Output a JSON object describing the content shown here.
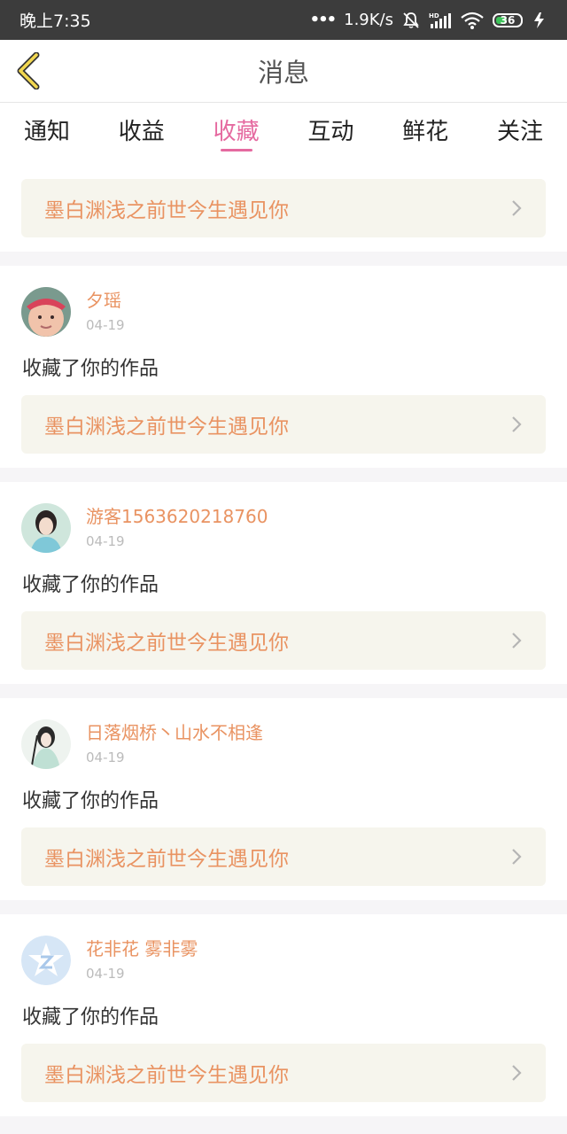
{
  "status_bar": {
    "time": "晚上7:35",
    "network_speed": "1.9K/s",
    "battery": "36",
    "icons": [
      "mute-icon",
      "signal-icon",
      "wifi-icon",
      "battery-icon",
      "charging-icon"
    ]
  },
  "header": {
    "title": "消息",
    "back_icon": "chevron-left-icon"
  },
  "tabs": [
    {
      "label": "通知",
      "active": false
    },
    {
      "label": "收益",
      "active": false
    },
    {
      "label": "收藏",
      "active": true
    },
    {
      "label": "互动",
      "active": false
    },
    {
      "label": "鲜花",
      "active": false
    },
    {
      "label": "关注",
      "active": false
    }
  ],
  "top_book": {
    "title": "墨白渊浅之前世今生遇见你"
  },
  "items": [
    {
      "user": "夕瑶",
      "date": "04-19",
      "action": "收藏了你的作品",
      "book": "墨白渊浅之前世今生遇见你"
    },
    {
      "user": "游客1563620218760",
      "date": "04-19",
      "action": "收藏了你的作品",
      "book": "墨白渊浅之前世今生遇见你"
    },
    {
      "user": "日落烟桥丶山水不相逢",
      "date": "04-19",
      "action": "收藏了你的作品",
      "book": "墨白渊浅之前世今生遇见你"
    },
    {
      "user": "花非花 雾非雾",
      "date": "04-19",
      "action": "收藏了你的作品",
      "book": "墨白渊浅之前世今生遇见你"
    }
  ],
  "colors": {
    "accent": "#e56aa0",
    "book_text": "#e99362",
    "book_bg": "#f6f5ed"
  }
}
